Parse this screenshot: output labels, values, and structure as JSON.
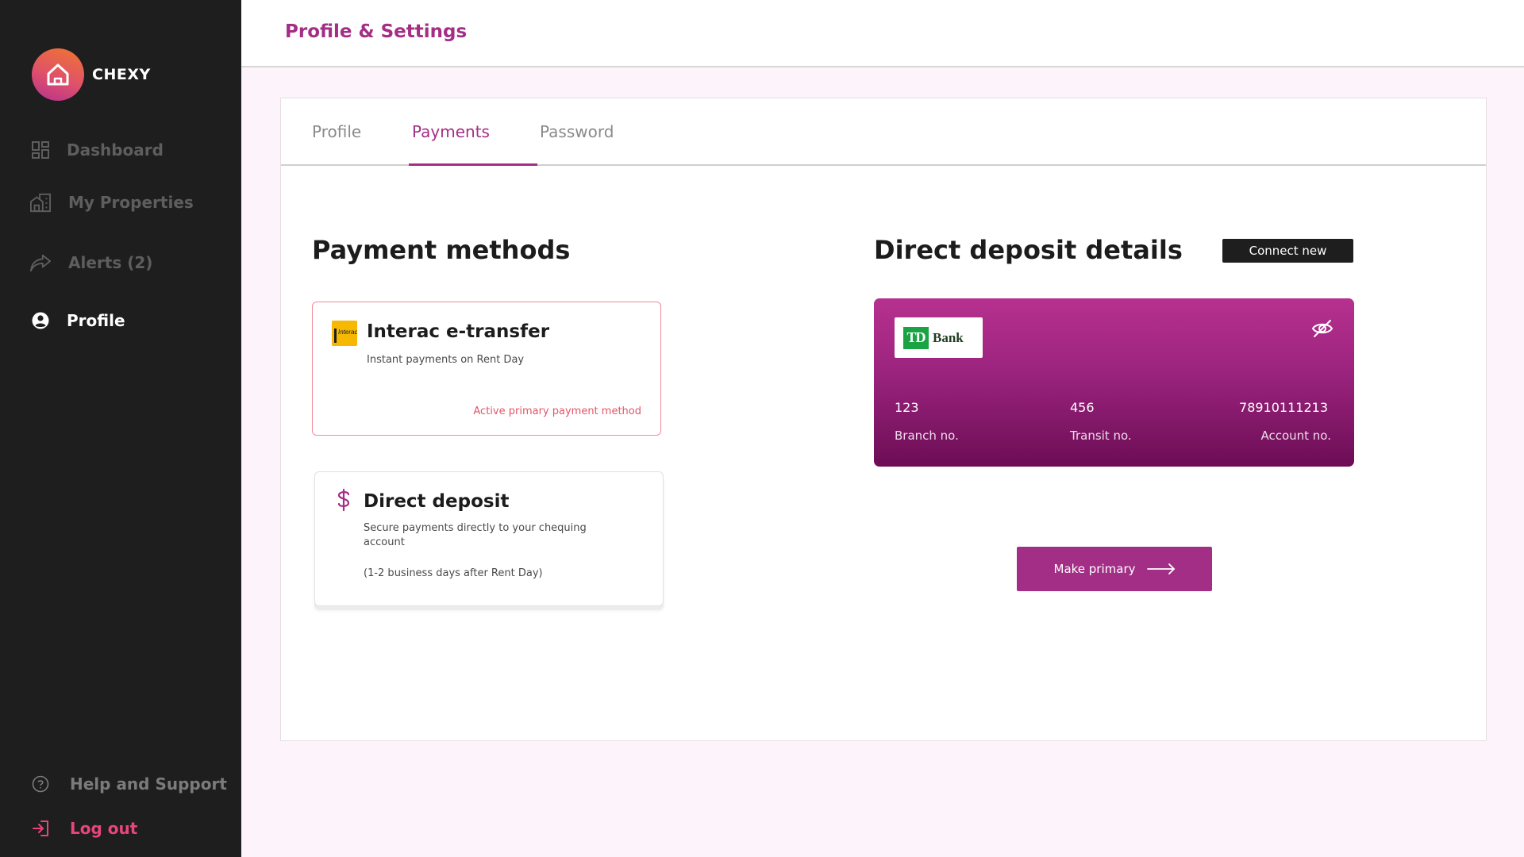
{
  "brand": {
    "name": "CHEXY"
  },
  "sidebar": {
    "items": [
      {
        "label": "Dashboard",
        "icon": "dashboard-icon"
      },
      {
        "label": "My Properties",
        "icon": "building-icon"
      },
      {
        "label": "Alerts (2)",
        "icon": "share-arrow-icon"
      },
      {
        "label": "Profile",
        "icon": "user-circle-icon",
        "active": true
      }
    ],
    "footer": [
      {
        "label": "Help and Support",
        "icon": "help-circle-icon"
      },
      {
        "label": "Log out",
        "icon": "logout-icon"
      }
    ]
  },
  "header": {
    "title": "Profile & Settings"
  },
  "tabs": [
    {
      "label": "Profile"
    },
    {
      "label": "Payments",
      "active": true
    },
    {
      "label": "Password"
    }
  ],
  "payment_methods": {
    "title": "Payment methods",
    "interac": {
      "title": "Interac e-transfer",
      "subtitle": "Instant payments on Rent Day",
      "status": "Active primary payment method",
      "icon_text": "Interac"
    },
    "direct_deposit": {
      "title": "Direct deposit",
      "subtitle": "Secure payments directly to your chequing account",
      "note": "(1-2 business days after Rent Day)"
    }
  },
  "direct_deposit_details": {
    "title": "Direct deposit details",
    "connect_label": "Connect new",
    "bank": {
      "logo_mark": "TD",
      "name": "Bank",
      "branch_no": "123",
      "branch_label": "Branch no.",
      "transit_no": "456",
      "transit_label": "Transit no.",
      "account_no": "78910111213",
      "account_label": "Account no."
    },
    "make_primary_label": "Make primary"
  },
  "colors": {
    "accent": "#a32e86",
    "sidebar_bg": "#1e1e1e",
    "logout": "#e8457c",
    "active_method_border": "#f08b96",
    "page_bg": "#fdf3fb"
  }
}
